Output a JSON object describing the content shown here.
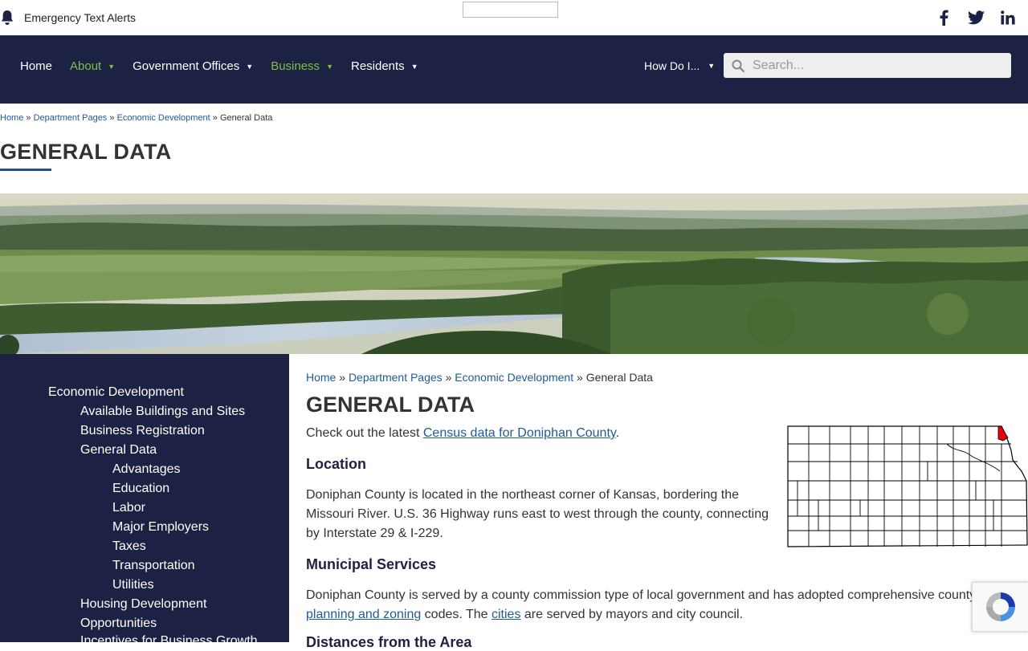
{
  "topbar": {
    "alert_label": "Emergency Text Alerts",
    "icons": [
      "bell-icon",
      "facebook-icon",
      "twitter-icon",
      "linkedin-icon"
    ]
  },
  "nav": {
    "items": [
      {
        "label": "Home",
        "dropdown": false,
        "active": false
      },
      {
        "label": "About",
        "dropdown": true,
        "active": true
      },
      {
        "label": "Government Offices",
        "dropdown": true,
        "active": false
      },
      {
        "label": "Business",
        "dropdown": true,
        "active": true
      },
      {
        "label": "Residents",
        "dropdown": true,
        "active": false
      }
    ],
    "howdoi_label": "How Do I...",
    "search_placeholder": "Search...",
    "colors": {
      "bar": "#1d2143",
      "active": "#7ac143"
    }
  },
  "breadcrumb": {
    "items": [
      "Home",
      "Department Pages",
      "Economic Development"
    ],
    "current": "General Data",
    "separator": "»"
  },
  "page_title": "GENERAL DATA",
  "sidebar": {
    "items": [
      {
        "label": "Economic Development",
        "level": 0
      },
      {
        "label": "Available Buildings and Sites",
        "level": 1
      },
      {
        "label": "Business Registration",
        "level": 1
      },
      {
        "label": "General Data",
        "level": 1
      },
      {
        "label": "Advantages",
        "level": 2
      },
      {
        "label": "Education",
        "level": 2
      },
      {
        "label": "Labor",
        "level": 2
      },
      {
        "label": "Major Employers",
        "level": 2
      },
      {
        "label": "Taxes",
        "level": 2
      },
      {
        "label": "Transportation",
        "level": 2
      },
      {
        "label": "Utilities",
        "level": 2
      },
      {
        "label": "Housing Development",
        "level": 1
      },
      {
        "label": "Opportunities",
        "level": 1
      },
      {
        "label": "Incentives for Business Growth",
        "level": 1
      }
    ]
  },
  "content": {
    "census_prefix": "Check out the latest ",
    "census_link": "Census data for Doniphan County",
    "census_suffix": ".",
    "location_heading": "Location",
    "location_text_line1": "Doniphan County is located in the northeast corner of Kansas, bordering the",
    "location_text_line2": "Missouri River. U.S. 36 Highway runs east to west through the county, connecting",
    "location_text_line3": "by Interstate 29 & I-229.",
    "municipal_heading": "Municipal Services",
    "municipal_text_line1": "Doniphan County is served by a county commission type of local government and has adopted comprehensive county",
    "municipal_link1": "planning and zoning",
    "municipal_mid": " codes. The ",
    "municipal_link2": "cities",
    "municipal_end": " are served by mayors and city council.",
    "distances_heading": "Distances from the Area"
  }
}
